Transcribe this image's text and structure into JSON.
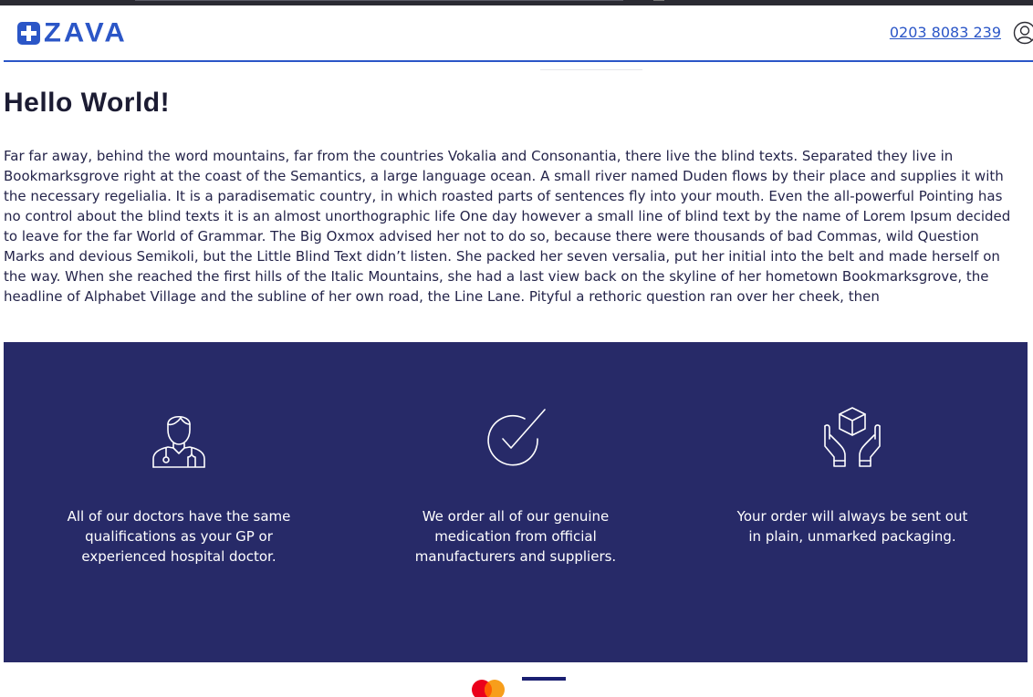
{
  "header": {
    "logo_text": "ZAVA",
    "phone": "0203 8083 239"
  },
  "page": {
    "title": "Hello World!",
    "body": "Far far away, behind the word mountains, far from the countries Vokalia and Consonantia, there live the blind texts. Separated they live in Bookmarksgrove right at the coast of the Semantics, a large language ocean. A small river named Duden flows by their place and supplies it with the necessary regelialia. It is a paradisematic country, in which roasted parts of sentences fly into your mouth. Even the all-powerful Pointing has no control about the blind texts it is an almost unorthographic life One day however a small line of blind text by the name of Lorem Ipsum decided to leave for the far World of Grammar. The Big Oxmox advised her not to do so, because there were thousands of bad Commas, wild Question Marks and devious Semikoli, but the Little Blind Text didn’t listen. She packed her seven versalia, put her initial into the belt and made herself on the way. When she reached the first hills of the Italic Mountains, she had a last view back on the skyline of her hometown Bookmarksgrove, the headline of Alphabet Village and the subline of her own road, the Line Lane. Pityful a rethoric question ran over her cheek, then"
  },
  "features": [
    {
      "icon": "doctor-icon",
      "text": "All of our doctors have the same qualifications as your GP or experienced hospital doctor."
    },
    {
      "icon": "checkmark-icon",
      "text": "We order all of our genuine medication from official manufacturers and suppliers."
    },
    {
      "icon": "package-hands-icon",
      "text": "Your order will always be sent out in plain, unmarked packaging."
    }
  ],
  "payments": [
    "mastercard-icon",
    "visa-icon"
  ],
  "colors": {
    "brand_blue": "#2b56c7",
    "features_bg": "#272a68",
    "text_dark": "#1c1c33"
  }
}
